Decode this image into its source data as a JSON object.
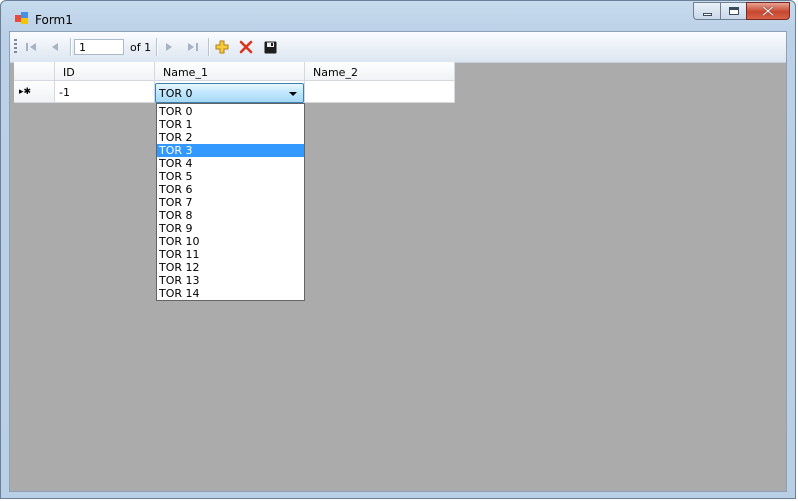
{
  "window": {
    "title": "Form1"
  },
  "navigator": {
    "position": "1",
    "count_label": "of 1"
  },
  "grid": {
    "columns": [
      "ID",
      "Name_1",
      "Name_2"
    ],
    "new_row": {
      "marker": "▸✱",
      "id": "-1",
      "name_1": "TOR 0",
      "name_2": ""
    }
  },
  "combo": {
    "value": "TOR 0",
    "options": [
      "TOR 0",
      "TOR 1",
      "TOR 2",
      "TOR 3",
      "TOR 4",
      "TOR 5",
      "TOR 6",
      "TOR 7",
      "TOR 8",
      "TOR 9",
      "TOR 10",
      "TOR 11",
      "TOR 12",
      "TOR 13",
      "TOR 14"
    ],
    "highlighted": "TOR 3"
  },
  "colors": {
    "highlight": "#3399ff",
    "client_bg": "#ababab",
    "add_icon": "#e8b019",
    "delete_icon": "#d9341c"
  }
}
